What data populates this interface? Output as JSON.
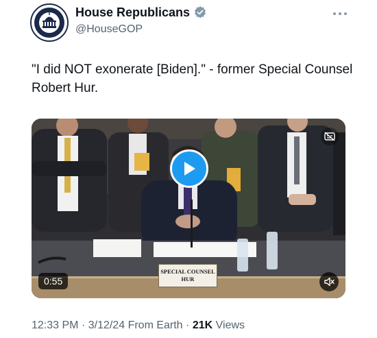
{
  "account": {
    "display_name": "House Republicans",
    "handle": "@HouseGOP"
  },
  "tweet": {
    "text": "\"I did NOT exonerate [Biden].\" - former Special Counsel Robert Hur."
  },
  "video": {
    "duration": "0:55",
    "placard_line1": "SPECIAL COUNSEL",
    "placard_line2": "HUR"
  },
  "meta": {
    "time": "12:33 PM",
    "date": "3/12/24",
    "source": "From Earth",
    "views_count": "21K",
    "views_label": "Views"
  },
  "icons": {
    "verified": "verified-badge-icon",
    "more": "more-options-icon",
    "play": "play-icon",
    "mute": "speaker-muted-icon",
    "captions": "captions-off-icon"
  },
  "colors": {
    "accent": "#1d9bf0",
    "secondary_text": "#536471",
    "primary_text": "#0f1419"
  }
}
